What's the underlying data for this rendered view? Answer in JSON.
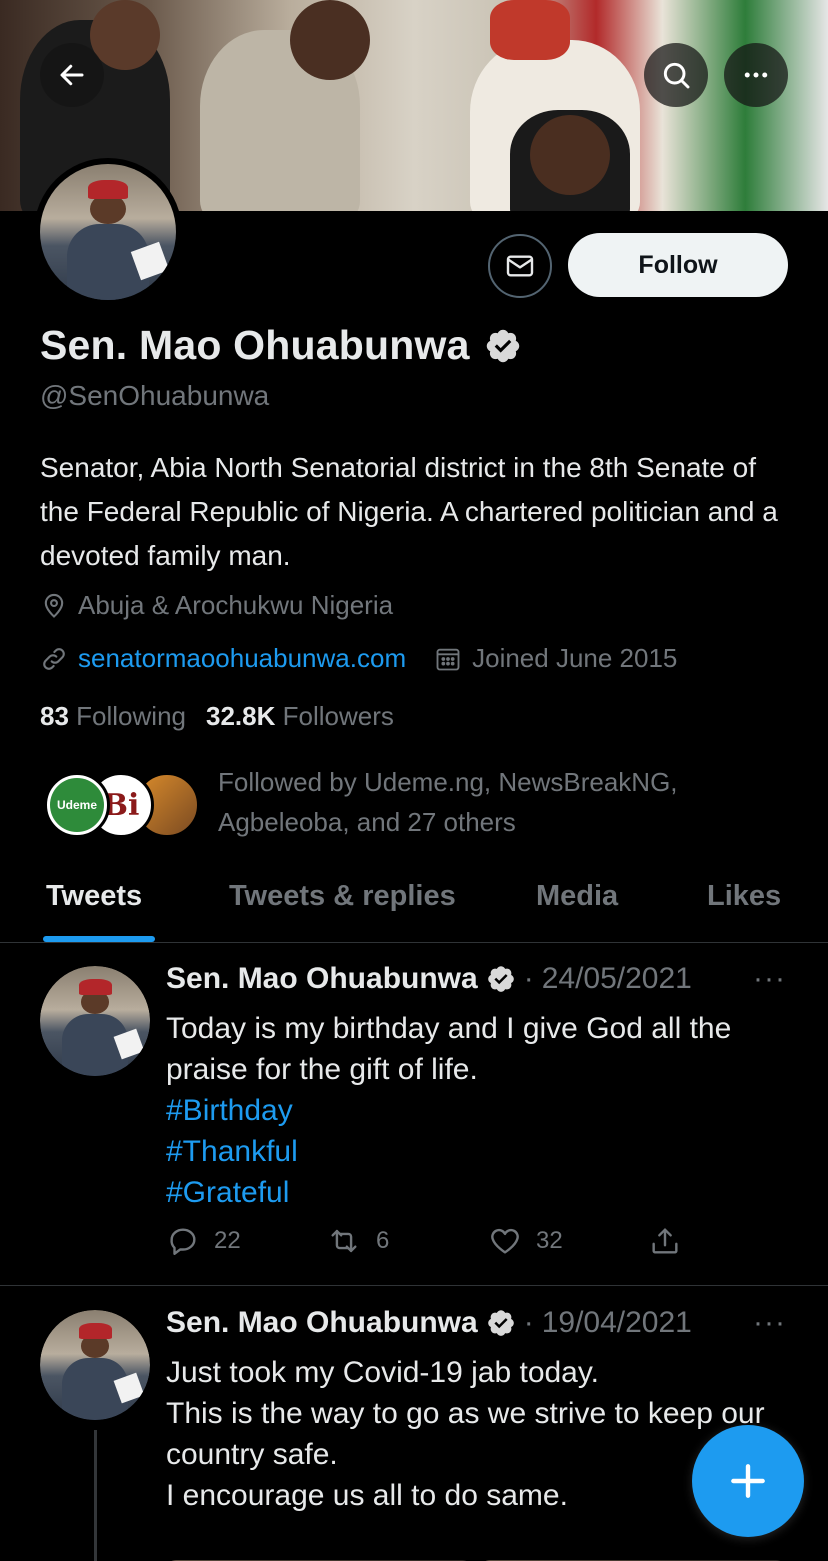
{
  "header": {
    "back_icon": "arrow-left-icon",
    "search_icon": "search-icon",
    "more_icon": "more-horizontal-icon"
  },
  "profile": {
    "name": "Sen. Mao Ohuabunwa",
    "handle": "@SenOhuabunwa",
    "verified_icon": "verified-badge-icon",
    "bio": "Senator, Abia North Senatorial district in the 8th Senate of the Federal Republic of Nigeria. A chartered politician and a devoted family man.",
    "location": "Abuja & Arochukwu Nigeria",
    "website": "senatormaoohuabunwa.com",
    "joined": "Joined June 2015",
    "following_count": "83",
    "following_label": "Following",
    "followers_count": "32.8K",
    "followers_label": "Followers",
    "followed_by": "Followed by Udeme.ng, NewsBreakNG, Agbeleoba, and 27 others",
    "follow_button": "Follow",
    "follower_avatar_1": "Udeme",
    "follower_avatar_2": "Bi"
  },
  "tabs": [
    "Tweets",
    "Tweets & replies",
    "Media",
    "Likes"
  ],
  "tweets": [
    {
      "author": "Sen. Mao Ohuabunwa",
      "date": "24/05/2021",
      "text": "Today is my birthday and I give God all the praise for the gift of life.",
      "hashtags": [
        "#Birthday",
        "#Thankful",
        "#Grateful"
      ],
      "replies": "22",
      "retweets": "6",
      "likes": "32"
    },
    {
      "author": "Sen. Mao Ohuabunwa",
      "date": "19/04/2021",
      "lines": [
        "Just took my Covid-19 jab today.",
        "This is the way to go as we strive to keep our country safe.",
        "I encourage us all to do same."
      ]
    }
  ],
  "more_dots": "···",
  "date_separator": "·",
  "colors": {
    "background": "#000000",
    "accent": "#1d9bf0",
    "secondary_text": "#71767b",
    "primary_text": "#e7e9ea"
  }
}
